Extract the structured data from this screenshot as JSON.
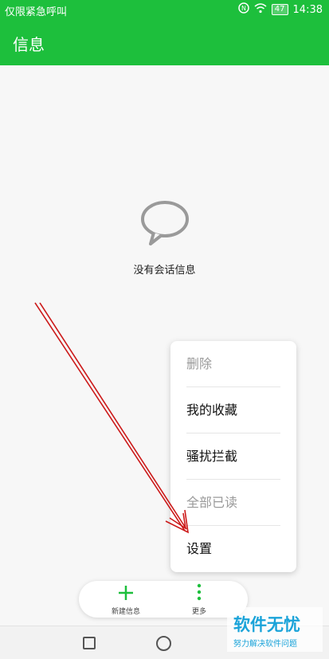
{
  "status_bar": {
    "carrier": "仅限紧急呼叫",
    "battery": "47",
    "time": "14:38"
  },
  "app_bar": {
    "title": "信息"
  },
  "empty_state": {
    "icon": "chat-bubble-icon",
    "message": "没有会话信息"
  },
  "menu": {
    "items": [
      {
        "label": "删除",
        "enabled": false
      },
      {
        "label": "我的收藏",
        "enabled": true
      },
      {
        "label": "骚扰拦截",
        "enabled": true
      },
      {
        "label": "全部已读",
        "enabled": false
      },
      {
        "label": "设置",
        "enabled": true
      }
    ]
  },
  "bottom_bar": {
    "new_message_label": "新建信息",
    "more_label": "更多"
  },
  "watermark": {
    "main": "软件无忧",
    "sub": "努力解决软件问题"
  },
  "colors": {
    "accent": "#1dbf3c",
    "arrow": "#cc1a1a",
    "watermark": "#1aa3d9"
  }
}
